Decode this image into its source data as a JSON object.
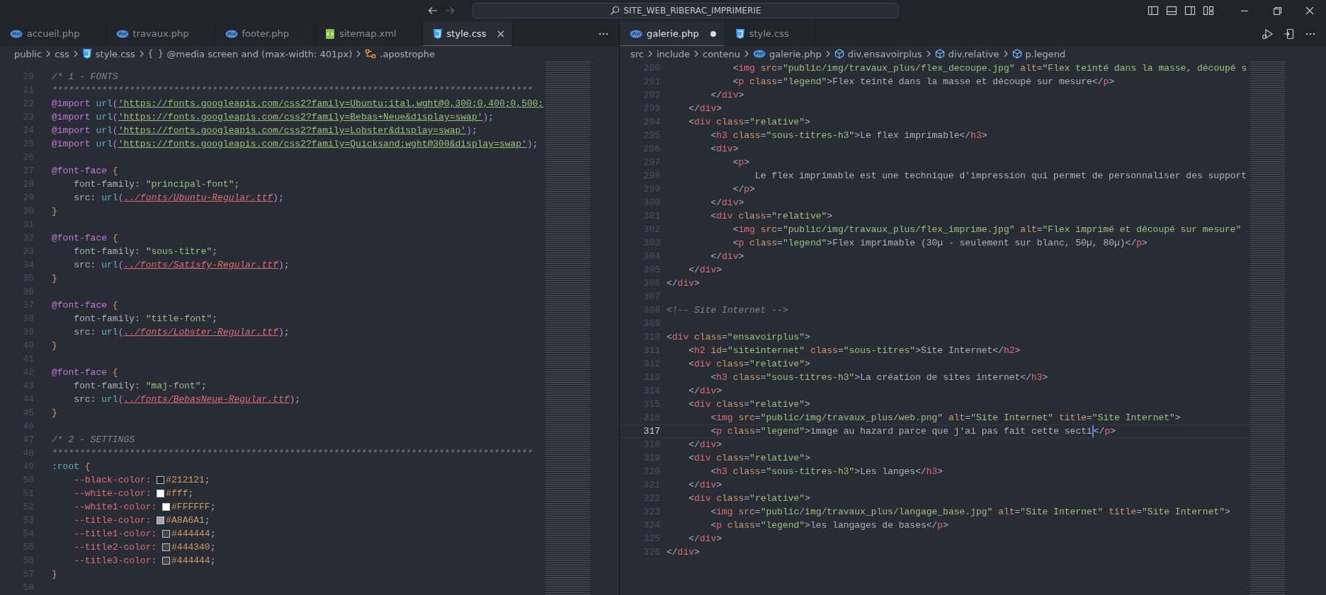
{
  "title_bar": {
    "navigation": {
      "back_disabled": false,
      "forward_disabled": true
    },
    "command_center": {
      "label": "SITE_WEB_RIBERAC_IMPRIMERIE"
    }
  },
  "editors": [
    {
      "kind": "css",
      "tabs": [
        {
          "label": "accueil.php",
          "kind": "php",
          "selected": false,
          "modified": false
        },
        {
          "label": "travaux.php",
          "kind": "php",
          "selected": false,
          "modified": false
        },
        {
          "label": "footer.php",
          "kind": "php",
          "selected": false,
          "modified": false
        },
        {
          "label": "sitemap.xml",
          "kind": "xml",
          "selected": false,
          "modified": false
        },
        {
          "label": "style.css",
          "kind": "css",
          "selected": true,
          "modified": false
        }
      ],
      "breadcrumbs": [
        {
          "label": "public",
          "kind": "folder"
        },
        {
          "label": "css",
          "kind": "folder"
        },
        {
          "label": "style.css",
          "kind": "css"
        },
        {
          "label": "@media screen and (max-width: 401px)",
          "kind": "symbol",
          "glyph": "{ }"
        },
        {
          "label": ".apostrophe",
          "kind": "class"
        }
      ],
      "lines": [
        {
          "number": "20",
          "text": "/* 1 - FONTS",
          "current": false
        },
        {
          "number": "21",
          "text": "***************************************************************************************",
          "current": false
        },
        {
          "number": "22",
          "text": "@import url('https://fonts.googleapis.com/css2?family=Ubuntu:ital,wght@0,300;0,400;0,500;",
          "current": false
        },
        {
          "number": "23",
          "text": "@import url('https://fonts.googleapis.com/css2?family=Bebas+Neue&display=swap');",
          "current": false
        },
        {
          "number": "24",
          "text": "@import url('https://fonts.googleapis.com/css2?family=Lobster&display=swap');",
          "current": false
        },
        {
          "number": "25",
          "text": "@import url('https://fonts.googleapis.com/css2?family=Quicksand:wght@300&display=swap');",
          "current": false
        },
        {
          "number": "26",
          "current": false
        },
        {
          "number": "27",
          "text": "@font-face {",
          "current": false
        },
        {
          "number": "28",
          "text": "    font-family: \"principal-font\";",
          "current": false
        },
        {
          "number": "29",
          "text": "    src: url(../fonts/Ubuntu-Regular.ttf);",
          "current": false
        },
        {
          "number": "30",
          "text": "}",
          "current": false
        },
        {
          "number": "31",
          "current": false
        },
        {
          "number": "32",
          "text": "@font-face {",
          "current": false
        },
        {
          "number": "33",
          "text": "    font-family: \"sous-titre\";",
          "current": false
        },
        {
          "number": "34",
          "text": "    src: url(../fonts/Satisfy-Regular.ttf);",
          "current": false
        },
        {
          "number": "35",
          "text": "}",
          "current": false
        },
        {
          "number": "36",
          "current": false
        },
        {
          "number": "37",
          "text": "@font-face {",
          "current": false
        },
        {
          "number": "38",
          "text": "    font-family: \"title-font\";",
          "current": false
        },
        {
          "number": "39",
          "text": "    src: url(../fonts/Lobster-Regular.ttf);",
          "current": false
        },
        {
          "number": "40",
          "text": "}",
          "current": false
        },
        {
          "number": "41",
          "current": false
        },
        {
          "number": "42",
          "text": "@font-face {",
          "current": false
        },
        {
          "number": "43",
          "text": "    font-family: \"maj-font\";",
          "current": false
        },
        {
          "number": "44",
          "text": "    src: url(../fonts/BebasNeue-Regular.ttf);",
          "current": false
        },
        {
          "number": "45",
          "text": "}",
          "current": false
        },
        {
          "number": "46",
          "current": false
        },
        {
          "number": "47",
          "text": "/* 2 - SETTINGS",
          "current": false
        },
        {
          "number": "48",
          "text": "***************************************************************************************",
          "current": false
        },
        {
          "number": "49",
          "text": ":root {",
          "current": false
        },
        {
          "number": "50",
          "text": "    --black-color: #212121;",
          "current": false
        },
        {
          "number": "51",
          "text": "    --white-color: #fff;",
          "current": false
        },
        {
          "number": "52",
          "text": "    --white1-color: #FFFFFF;",
          "current": false
        },
        {
          "number": "53",
          "text": "    --title-color: #A8A6A1;",
          "current": false
        },
        {
          "number": "54",
          "text": "    --title1-color: #444444;",
          "current": false
        },
        {
          "number": "55",
          "text": "    --title2-color: #444340;",
          "current": false
        },
        {
          "number": "56",
          "text": "    --title3-color: #444444;",
          "current": false
        },
        {
          "number": "57",
          "text": "}",
          "current": false
        },
        {
          "number": "58",
          "current": false
        }
      ]
    },
    {
      "kind": "html",
      "tabs": [
        {
          "label": "galerie.php",
          "kind": "php",
          "selected": true,
          "modified": true
        },
        {
          "label": "style.css",
          "kind": "css",
          "selected": false,
          "modified": false
        }
      ],
      "breadcrumbs": [
        {
          "label": "src",
          "kind": "folder"
        },
        {
          "label": "include",
          "kind": "folder"
        },
        {
          "label": "contenu",
          "kind": "folder"
        },
        {
          "label": "galerie.php",
          "kind": "php"
        },
        {
          "label": "div.ensavoirplus",
          "kind": "element"
        },
        {
          "label": "div.relative",
          "kind": "element"
        },
        {
          "label": "p.legend",
          "kind": "element"
        }
      ],
      "lines": [
        {
          "number": "290",
          "text": "            <img src=\"public/img/travaux_plus/flex_decoupe.jpg\" alt=\"Flex teinté dans la masse, découpé s",
          "current": false
        },
        {
          "number": "291",
          "text": "            <p class=\"legend\">Flex teinté dans la masse et découpé sur mesure</p>",
          "current": false
        },
        {
          "number": "292",
          "text": "        </div>",
          "current": false
        },
        {
          "number": "293",
          "text": "    </div>",
          "current": false
        },
        {
          "number": "294",
          "text": "    <div class=\"relative\">",
          "current": false
        },
        {
          "number": "295",
          "text": "        <h3 class=\"sous-titres-h3\">Le flex imprimable</h3>",
          "current": false
        },
        {
          "number": "296",
          "text": "        <div>",
          "current": false
        },
        {
          "number": "297",
          "text": "            <p>",
          "current": false
        },
        {
          "number": "298",
          "text": "                Le flex imprimable est une technique d'impression qui permet de personnaliser des support",
          "current": false
        },
        {
          "number": "299",
          "text": "            </p>",
          "current": false
        },
        {
          "number": "300",
          "text": "        </div>",
          "current": false
        },
        {
          "number": "301",
          "text": "        <div class=\"relative\">",
          "current": false
        },
        {
          "number": "302",
          "text": "            <img src=\"public/img/travaux_plus/flex_imprime.jpg\" alt=\"Flex imprimé et découpé sur mesure\"",
          "current": false
        },
        {
          "number": "303",
          "text": "            <p class=\"legend\">Flex imprimable (30µ - seulement sur blanc, 50µ, 80µ)</p>",
          "current": false
        },
        {
          "number": "304",
          "text": "        </div>",
          "current": false
        },
        {
          "number": "305",
          "text": "    </div>",
          "current": false
        },
        {
          "number": "306",
          "text": "</div>",
          "current": false
        },
        {
          "number": "307",
          "current": false
        },
        {
          "number": "308",
          "text": "<!-- Site Internet -->",
          "current": false
        },
        {
          "number": "309",
          "current": false
        },
        {
          "number": "310",
          "text": "<div class=\"ensavoirplus\">",
          "current": false
        },
        {
          "number": "311",
          "text": "    <h2 id=\"siteinternet\" class=\"sous-titres\">Site Internet</h2>",
          "current": false
        },
        {
          "number": "312",
          "text": "    <div class=\"relative\">",
          "current": false
        },
        {
          "number": "313",
          "text": "        <h3 class=\"sous-titres-h3\">La création de sites internet</h3>",
          "current": false
        },
        {
          "number": "314",
          "text": "    </div>",
          "current": false
        },
        {
          "number": "315",
          "text": "    <div class=\"relative\">",
          "current": false
        },
        {
          "number": "316",
          "text": "        <img src=\"public/img/travaux_plus/web.png\" alt=\"Site Internet\" title=\"Site Internet\">",
          "current": false
        },
        {
          "number": "317",
          "text": "        <p class=\"legend\">image au hazard parce que j'ai pas fait cette secti",
          "text_after_cursor": "</p>",
          "current": true
        },
        {
          "number": "318",
          "text": "    </div>",
          "current": false
        },
        {
          "number": "319",
          "text": "    <div class=\"relative\">",
          "current": false
        },
        {
          "number": "320",
          "text": "        <h3 class=\"sous-titres-h3\">Les langes</h3>",
          "current": false
        },
        {
          "number": "321",
          "text": "    </div>",
          "current": false
        },
        {
          "number": "322",
          "text": "    <div class=\"relative\">",
          "current": false
        },
        {
          "number": "323",
          "text": "        <img src=\"public/img/travaux_plus/langage_base.jpg\" alt=\"Site Internet\" title=\"Site Internet\">",
          "current": false
        },
        {
          "number": "324",
          "text": "        <p class=\"legend\">les langages de bases</p>",
          "current": false
        },
        {
          "number": "325",
          "text": "    </div>",
          "current": false
        },
        {
          "number": "326",
          "text": "</div>",
          "current": false
        }
      ]
    }
  ]
}
